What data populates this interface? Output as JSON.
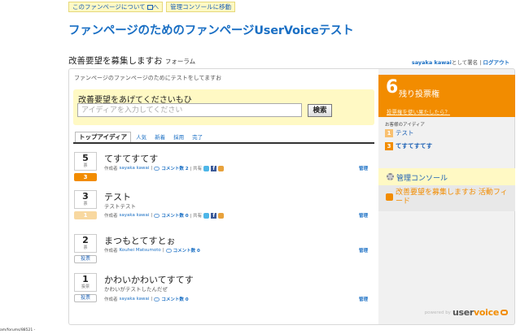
{
  "top_buttons": {
    "about": "このファンページについて",
    "admin": "管理コンソールに移動"
  },
  "site_title": "ファンページのためのファンページUserVoiceテスト",
  "forum": {
    "name": "改善要望を募集しますお",
    "suffix": "フォーラム",
    "description": "ファンページのファンページのためにテストをしてますお"
  },
  "account": {
    "user": "sayaka kawai",
    "signed_as": "として署名",
    "separator": "|",
    "logout": "ログアウト"
  },
  "idea_form": {
    "heading": "改善要望をあげてくださいもひ",
    "placeholder": "アイディアを入力してください",
    "search_label": "検索"
  },
  "tabs": [
    {
      "label": "トップアイディア"
    },
    {
      "label": "人気"
    },
    {
      "label": "新着"
    },
    {
      "label": "採用"
    },
    {
      "label": "完了"
    }
  ],
  "ideas": [
    {
      "votes": "5",
      "unit": "票",
      "title": "てすてすてす",
      "description": "",
      "author_prefix": "作成者",
      "author": "sayaka kawai",
      "sep": "|",
      "comments": "コメント数 2",
      "share": "| 共有",
      "my_votes": "3",
      "admin": "管理"
    },
    {
      "votes": "3",
      "unit": "票",
      "title": "テスト",
      "description": "テストテスト",
      "author_prefix": "作成者",
      "author": "sayaka kawai",
      "sep": "|",
      "comments": "コメント数 0",
      "share": "| 共有",
      "my_votes": "1",
      "admin": "管理"
    },
    {
      "votes": "2",
      "unit": "票",
      "title": "まつもとてすとぉ",
      "description": "",
      "author_prefix": "作成者",
      "author": "Kouhei Matsumoto",
      "sep": "|",
      "comments": "コメント数 0",
      "share": "",
      "my_votes": "投票",
      "admin": "管理"
    },
    {
      "votes": "1",
      "unit": "投票",
      "title": "かわいかわいてすてす",
      "description": "かわいがテストしたんだぜ",
      "author_prefix": "作成者",
      "author": "sayaka kawai",
      "sep": "|",
      "comments": "コメント数 0",
      "share": "",
      "my_votes": "投票",
      "admin": "管理"
    }
  ],
  "sidebar": {
    "votes_left": "6",
    "votes_left_label": "残り投票権",
    "votes_help": "投票権を使い果たしたら？",
    "my_ideas_heading": "お客様のアイディア",
    "my_ideas": [
      {
        "badge": "1",
        "label": "テスト"
      },
      {
        "badge": "3",
        "label": "てすてすてす"
      }
    ],
    "admin_console": "管理コンソール",
    "feed": "改善要望を募集しますお 活動フィード",
    "powered_by": "powered by",
    "logo_main": "user",
    "logo_accent": "voice"
  },
  "status_bar": "am/forums/88521 -",
  "colors": {
    "accent_orange": "#f28c00",
    "link_blue": "#1a6fc4",
    "highlight_yellow": "#fff9c4"
  }
}
